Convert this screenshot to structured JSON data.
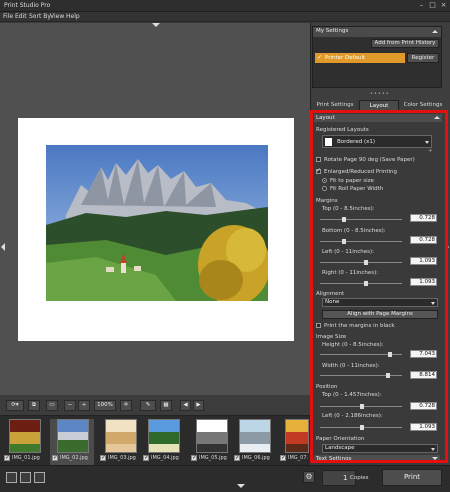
{
  "app": {
    "title": "Print Studio Pro"
  },
  "menu": [
    "File",
    "Edit",
    "Sort By",
    "View",
    "Help"
  ],
  "toolbar": {
    "zoom": "100%"
  },
  "filmstrip": [
    {
      "name": "IMG_01.jpg",
      "colors": [
        "#6c1f12",
        "#c9a23a",
        "#3f7a2c"
      ]
    },
    {
      "name": "IMG_02.jpg",
      "colors": [
        "#5d86c4",
        "#c9ced6",
        "#3b6b2d"
      ]
    },
    {
      "name": "IMG_03.jpg",
      "colors": [
        "#f0e2c2",
        "#d2a96b",
        "#e6c79a"
      ]
    },
    {
      "name": "IMG_04.jpg",
      "colors": [
        "#5a9be0",
        "#2f6a2c",
        "#e7e1b8"
      ]
    },
    {
      "name": "IMG_05.jpg",
      "colors": [
        "#ffffff",
        "#777777",
        "#333333"
      ]
    },
    {
      "name": "IMG_06.jpg",
      "colors": [
        "#bcd6e8",
        "#8c9aa5",
        "#e9eef2"
      ]
    },
    {
      "name": "IMG_07.jpg",
      "colors": [
        "#e6b03a",
        "#c23a22",
        "#5b2a18"
      ]
    }
  ],
  "bottom": {
    "copies_value": "1",
    "copies_label": "Copies",
    "print_label": "Print"
  },
  "my_settings": {
    "title": "My Settings",
    "add_label": "Add from Print History",
    "item": "Printer Default",
    "register_label": "Register"
  },
  "tabs": {
    "print_settings": "Print Settings",
    "layout": "Layout",
    "color_settings": "Color Settings"
  },
  "layout_panel": {
    "section_title": "Layout",
    "registered_layouts_label": "Registered Layouts",
    "registered_layout_value": "Bordered (x1)",
    "rotate_label": "Rotate Page 90 deg (Save Paper)",
    "enlarged_label": "Enlarged/Reduced Printing",
    "fit_paper_label": "Fit to paper size",
    "fit_roll_label": "Fit Roll Paper Width",
    "margins_label": "Margins",
    "top_label": "Top (0 - 8.5inches):",
    "top_value": "0.728",
    "bottom_label": "Bottom (0 - 8.5inches):",
    "bottom_value": "0.728",
    "left_label": "Left (0 - 11inches):",
    "left_value": "1.093",
    "right_label": "Right (0 - 11inches):",
    "right_value": "1.093",
    "alignment_label": "Alignment",
    "alignment_value": "None",
    "align_button": "Align with Page Margins",
    "print_margins_label": "Print the margins in black",
    "image_size_label": "Image Size",
    "height_label": "Height (0 - 8.5inches):",
    "height_value": "7.043",
    "width_label": "Width (0 - 11inches):",
    "width_value": "8.814",
    "position_label": "Position",
    "pos_top_label": "Top (0 - 1.457inches):",
    "pos_top_value": "0.728",
    "pos_left_label": "Left (0 - 2.186inches):",
    "pos_left_value": "1.093",
    "orientation_label": "Paper Orientation",
    "orientation_value": "Landscape",
    "text_settings": "Text Settings"
  },
  "colors": {
    "highlight": "#e41010",
    "accent": "#e09a2c"
  }
}
